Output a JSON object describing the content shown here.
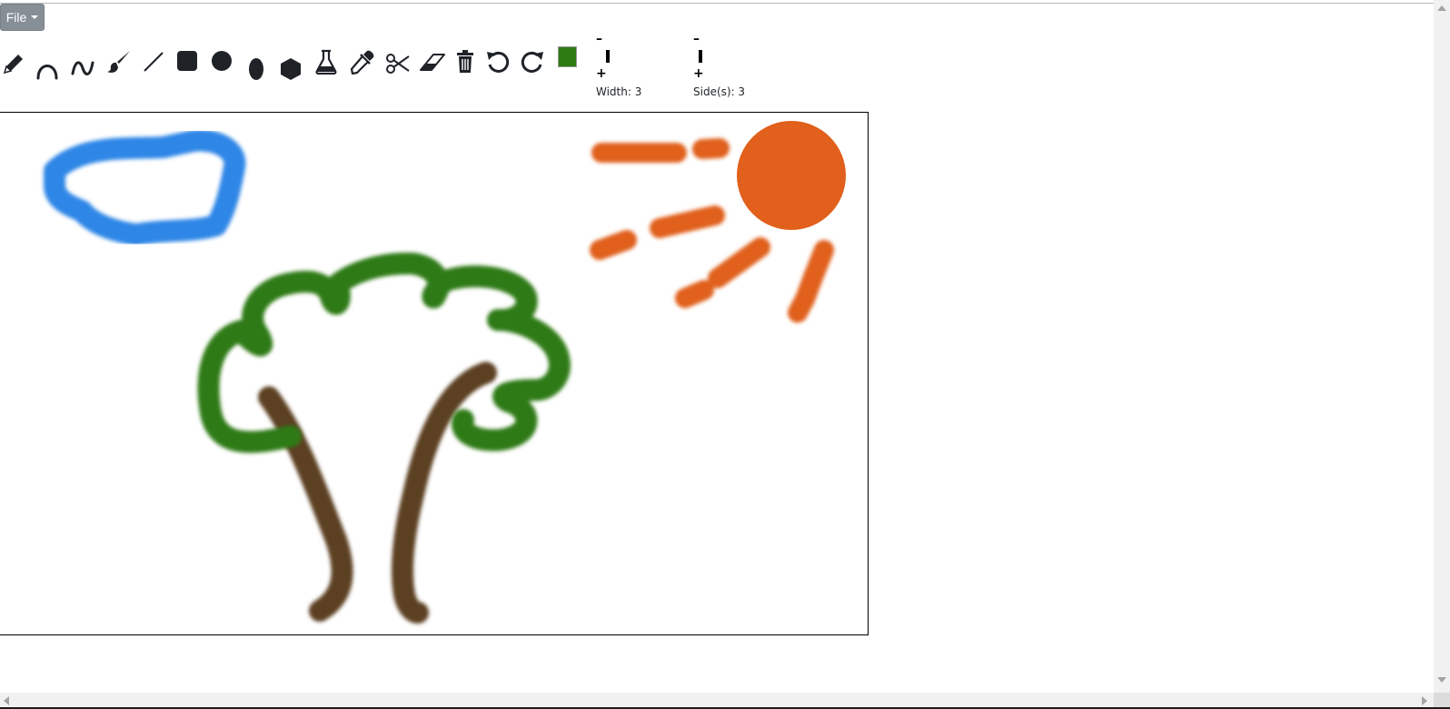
{
  "menu": {
    "file_label": "File"
  },
  "toolbar": {
    "tools": [
      {
        "name": "pencil-icon",
        "label": "Pencil"
      },
      {
        "name": "curve-icon",
        "label": "Curve"
      },
      {
        "name": "wave-icon",
        "label": "Freehand"
      },
      {
        "name": "paintbrush-icon",
        "label": "Brush"
      },
      {
        "name": "line-icon",
        "label": "Line"
      },
      {
        "name": "square-icon",
        "label": "Rectangle"
      },
      {
        "name": "circle-icon",
        "label": "Circle"
      },
      {
        "name": "ellipse-icon",
        "label": "Ellipse"
      },
      {
        "name": "hexagon-icon",
        "label": "Polygon"
      },
      {
        "name": "flask-icon",
        "label": "Fill"
      },
      {
        "name": "eyedropper-icon",
        "label": "Color picker"
      },
      {
        "name": "scissors-icon",
        "label": "Cut"
      },
      {
        "name": "eraser-icon",
        "label": "Eraser"
      },
      {
        "name": "trash-icon",
        "label": "Clear"
      },
      {
        "name": "undo-icon",
        "label": "Undo"
      },
      {
        "name": "redo-icon",
        "label": "Redo"
      }
    ],
    "current_color": "#2e7a12",
    "width": {
      "minus": "–",
      "plus": "+",
      "label": "Width: 3"
    },
    "sides": {
      "minus": "–",
      "plus": "+",
      "label": "Side(s): 3"
    }
  },
  "colors": {
    "cloud": "#2e86e6",
    "sun": "#e0601c",
    "foliage": "#2e7a12",
    "trunk": "#5b3f22"
  }
}
